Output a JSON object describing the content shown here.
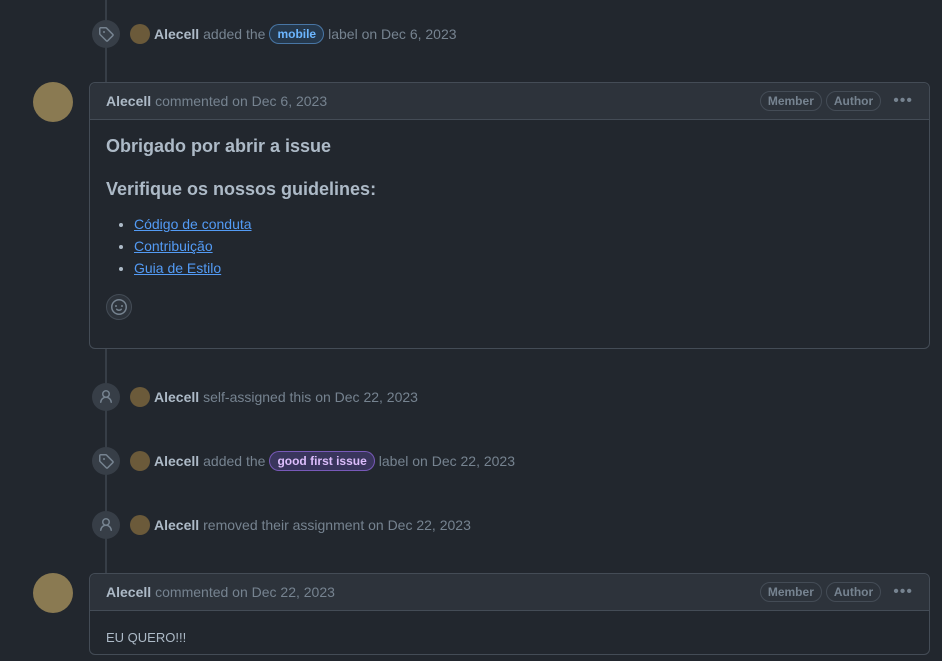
{
  "events": [
    {
      "user": "Alecell",
      "pre": "added the",
      "label": "mobile",
      "post": "label on Dec 6, 2023"
    },
    {
      "user": "Alecell",
      "text": "self-assigned this on Dec 22, 2023"
    },
    {
      "user": "Alecell",
      "pre": "added the",
      "label": "good first issue",
      "post": "label on Dec 22, 2023"
    },
    {
      "user": "Alecell",
      "text": "removed their assignment on Dec 22, 2023"
    }
  ],
  "comment1": {
    "user": "Alecell",
    "meta": "commented on Dec 6, 2023",
    "badges": [
      "Member",
      "Author"
    ],
    "heading1": "Obrigado por abrir a issue",
    "heading2": "Verifique os nossos guidelines:",
    "links": [
      "Código de conduta",
      "Contribuição",
      "Guia de Estilo"
    ]
  },
  "comment2": {
    "user": "Alecell",
    "meta": "commented on Dec 22, 2023",
    "badges": [
      "Member",
      "Author"
    ],
    "partial_text": "EU QUERO!!!"
  },
  "icons": {
    "tag": "tag-icon",
    "person": "person-icon",
    "smiley": "smiley-icon",
    "kebab": "kebab-horizontal-icon"
  },
  "colors": {
    "background": "#22272e",
    "link": "#539bf5",
    "mobile_label": "#6cb6ff",
    "gfi_label": "#dcbdfb"
  }
}
